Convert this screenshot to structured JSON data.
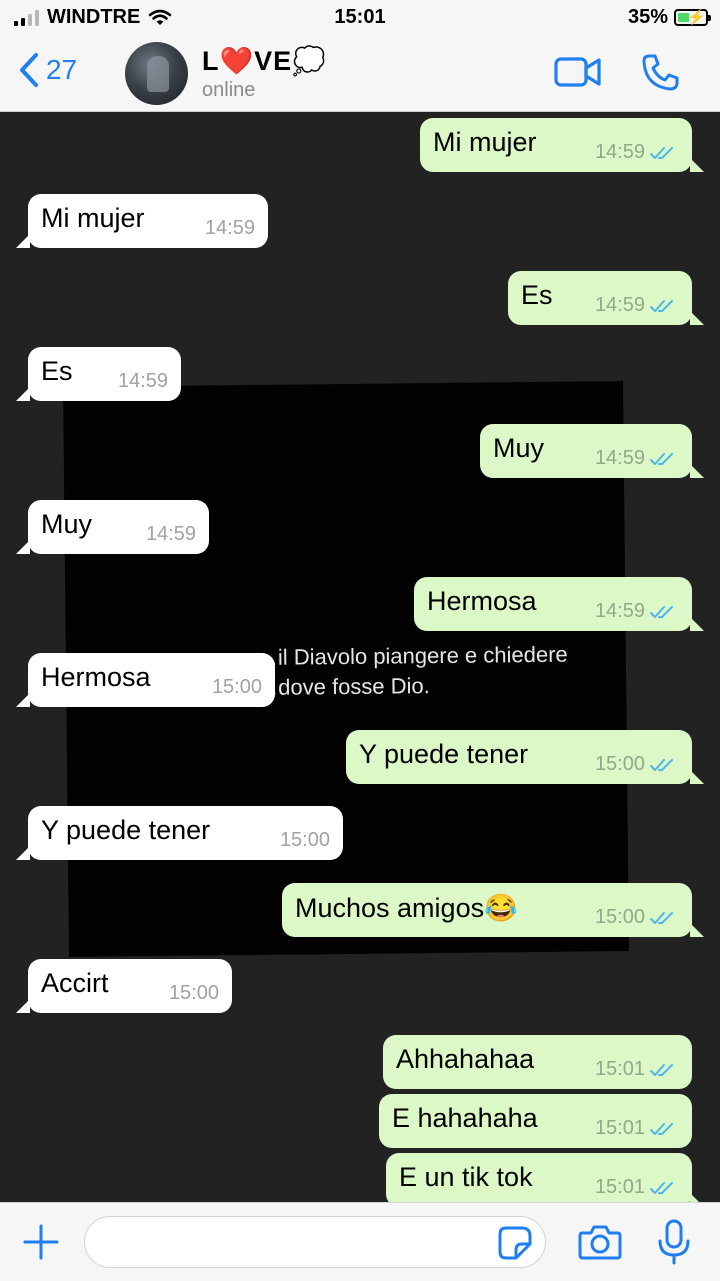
{
  "status_bar": {
    "carrier": "WINDTRE",
    "time": "15:01",
    "battery": "35%"
  },
  "header": {
    "back_count": "27",
    "contact_name": "L❤️VE💭",
    "contact_status": "online"
  },
  "background_photo": {
    "caption_line1": "…il Diavolo piangere e chiedere",
    "caption_line2": "…dove fosse  Dio."
  },
  "messages": [
    {
      "dir": "out",
      "text": "Mi mujer",
      "time": "14:59",
      "read": true
    },
    {
      "dir": "in",
      "text": "Mi mujer",
      "time": "14:59"
    },
    {
      "dir": "out",
      "text": "Es",
      "time": "14:59",
      "read": true
    },
    {
      "dir": "in",
      "text": "Es",
      "time": "14:59"
    },
    {
      "dir": "out",
      "text": "Muy",
      "time": "14:59",
      "read": true
    },
    {
      "dir": "in",
      "text": "Muy",
      "time": "14:59"
    },
    {
      "dir": "out",
      "text": "Hermosa",
      "time": "14:59",
      "read": true
    },
    {
      "dir": "in",
      "text": "Hermosa",
      "time": "15:00"
    },
    {
      "dir": "out",
      "text": "Y puede tener",
      "time": "15:00",
      "read": true
    },
    {
      "dir": "in",
      "text": "Y puede tener",
      "time": "15:00"
    },
    {
      "dir": "out",
      "text": "Muchos amigos😂",
      "time": "15:00",
      "read": true
    },
    {
      "dir": "in",
      "text": "Accirt",
      "time": "15:00"
    },
    {
      "dir": "out",
      "text": "Ahhahahaa",
      "time": "15:01",
      "read": true
    },
    {
      "dir": "out",
      "text": "E hahahaha",
      "time": "15:01",
      "read": true
    },
    {
      "dir": "out",
      "text": "E un tik tok",
      "time": "15:01",
      "read": true
    }
  ],
  "composer": {
    "placeholder": ""
  },
  "colors": {
    "accent": "#1f7ff0",
    "outgoing_bubble": "#dcf8c6",
    "incoming_bubble": "#ffffff",
    "read_ticks": "#4fb6ec",
    "chat_background": "#222222"
  },
  "icons": {
    "back": "chevron-left-icon",
    "video_call": "video-camera-icon",
    "voice_call": "phone-icon",
    "attach": "plus-icon",
    "sticker": "sticker-icon",
    "camera": "camera-icon",
    "microphone": "microphone-icon",
    "read_receipt": "double-check-icon"
  }
}
